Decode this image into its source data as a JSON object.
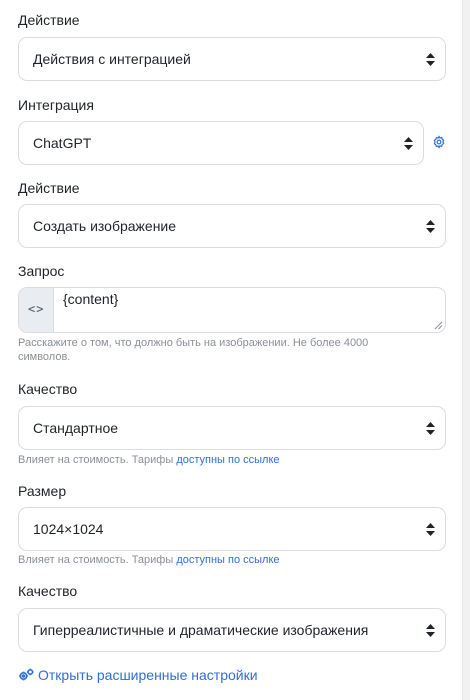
{
  "fields": {
    "action1": {
      "label": "Действие",
      "value": "Действия с интеграцией"
    },
    "integration": {
      "label": "Интеграция",
      "value": "ChatGPT"
    },
    "action2": {
      "label": "Действие",
      "value": "Создать изображение"
    },
    "request": {
      "label": "Запрос",
      "addon_icon": "code-icon",
      "addon_text": "<>",
      "value": "{content}",
      "hint": "Расскажите о том, что должно быть на изображении. Не более 4000 символов."
    },
    "quality": {
      "label": "Качество",
      "value": "Стандартное",
      "hint_text": "Влияет на стоимость. Тарифы",
      "hint_link": "доступны по ссылке"
    },
    "size": {
      "label": "Размер",
      "value": "1024×1024",
      "hint_text": "Влияет на стоимость. Тарифы",
      "hint_link": "доступны по ссылке"
    },
    "style": {
      "label": "Качество",
      "value": "Гиперреалистичные и драматические изображения"
    }
  },
  "advanced_link": "Открыть расширенные настройки",
  "icons": {
    "select_arrows": "sort-arrows-icon",
    "integration_settings": "gear-icon",
    "advanced": "gears-icon"
  },
  "colors": {
    "link": "#2f6fd6",
    "border": "#d9dce1",
    "hint": "#8a8f98",
    "addon_bg": "#e9ecf0"
  }
}
